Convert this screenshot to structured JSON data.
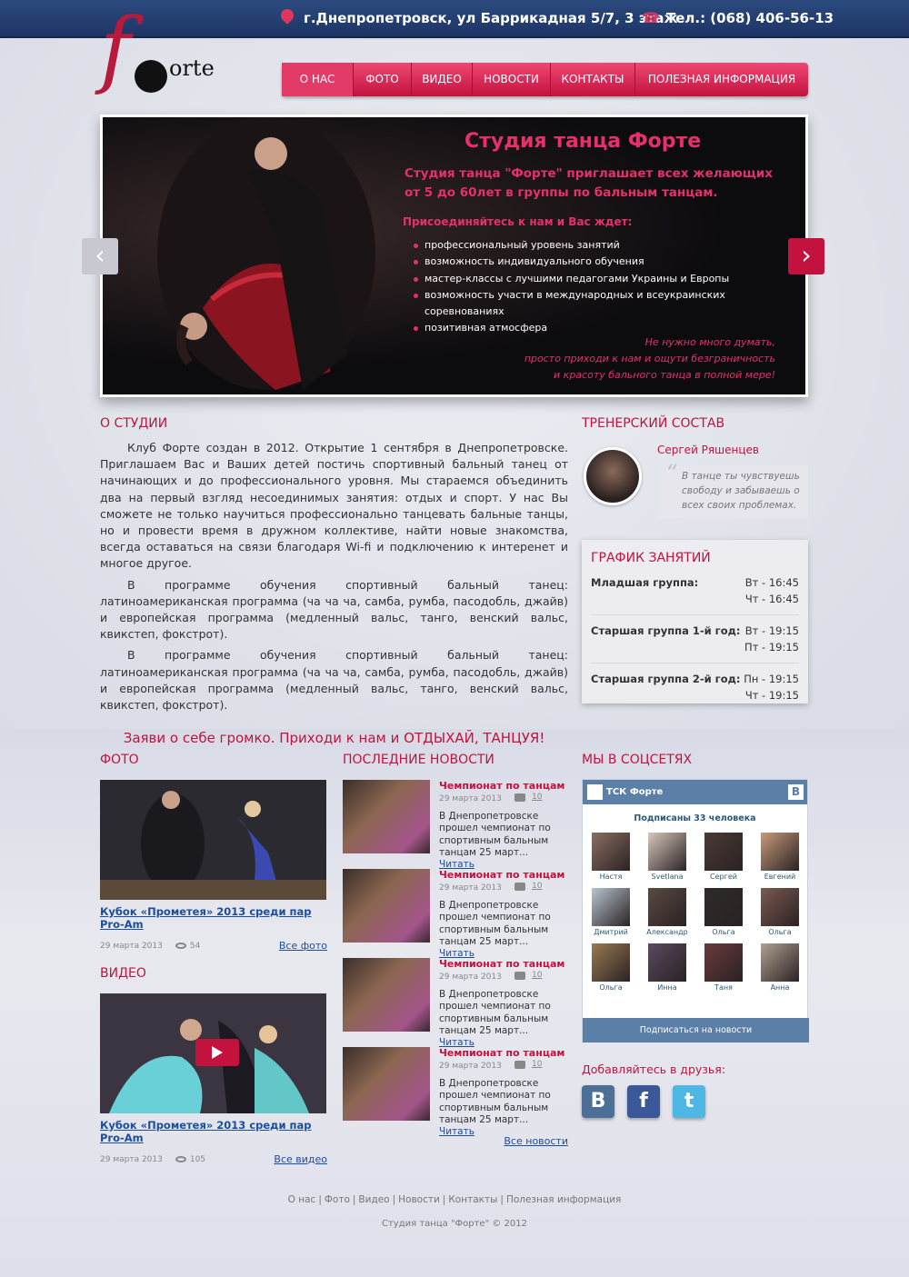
{
  "header": {
    "address": "г.Днепропетровск, ул Баррикадная 5/7, 3 этаж",
    "phone": "Тел.: (068) 406-56-13",
    "logo_letter": "f",
    "logo_text": "orte"
  },
  "nav": [
    {
      "label": "О НАС",
      "active": true
    },
    {
      "label": "ФОТО"
    },
    {
      "label": "ВИДЕО"
    },
    {
      "label": "НОВОСТИ"
    },
    {
      "label": "КОНТАКТЫ"
    },
    {
      "label": "ПОЛЕЗНАЯ ИНФОРМАЦИЯ"
    }
  ],
  "slider": {
    "title": "Студия танца Форте",
    "intro": "Студия танца \"Форте\" приглашает всех желающих от 5 до 60лет в группы по бальным танцам.",
    "join": "Присоединяйтесь к нам и Вас ждет:",
    "bullets": [
      "профессиональный уровень занятий",
      "возможность индивидуального обучения",
      "мастер-классы с лучшими педагогами Украины и Европы",
      "возможность участи в международных и всеукраинских соревнованиях",
      "позитивная атмосфера"
    ],
    "quote_lines": [
      "Не нужно много думать,",
      "просто приходи к нам и ощути безграничность",
      "и красоту бального танца в полной мере!"
    ]
  },
  "about": {
    "heading": "О СТУДИИ",
    "paragraphs": [
      "Клуб Форте создан в 2012. Открытие 1 сентября в Днепропетровске. Приглашаем Вас и Ваших детей постичь спортивный бальный танец от начинающих и до профессионального уровня. Мы стараемся объединить два на первый взгляд несоединимых занятия: отдых и спорт. У нас Вы сможете не только научиться профессионально танцевать бальные танцы, но и провести время в дружном коллективе, найти новые знакомства, всегда оставаться на связи благодаря Wi-fi и подключению к интеренет и многое другое.",
      "В программе обучения спортивный бальный танец: латиноамериканская программа (ча ча ча, самба, румба, пасодобль, джайв) и европейская программа (медленный вальс, танго, венский вальс, квикстеп, фокстрот).",
      "В программе обучения спортивный бальный танец: латиноамериканская программа (ча ча ча, самба, румба, пасодобль, джайв) и европейская программа (медленный вальс, танго, венский вальс, квикстеп, фокстрот)."
    ],
    "slogan": "Заяви о себе громко. Приходи к нам и ОТДЫХАЙ, ТАНЦУЯ!"
  },
  "trainers": {
    "heading": "ТРЕНЕРСКИЙ СОСТАВ",
    "name": "Сергей Ряшенцев",
    "quote": "В танце ты чувствуешь свободу и забываешь о всех своих проблемах."
  },
  "schedule": {
    "heading": "ГРАФИК ЗАНЯТИЙ",
    "rows": [
      {
        "group": "Младшая группа:",
        "times": [
          "Вт - 16:45",
          "Чт - 16:45"
        ]
      },
      {
        "group": "Старшая группа 1-й год:",
        "times": [
          "Вт - 19:15",
          "Пт - 19:15"
        ]
      },
      {
        "group": "Старшая группа 2-й год:",
        "times": [
          "Пн - 19:15",
          "Чт - 19:15"
        ]
      }
    ]
  },
  "photo": {
    "heading": "ФОТО",
    "caption": "Кубок «Прометея» 2013 среди пар Pro-Am",
    "date": "29 марта 2013",
    "views": "54",
    "all_link": "Все фото"
  },
  "video": {
    "heading": "ВИДЕО",
    "caption": "Кубок «Прометея» 2013 среди пар Pro-Am",
    "date": "29 марта 2013",
    "views": "105",
    "all_link": "Все видео"
  },
  "news": {
    "heading": "ПОСЛЕДНИЕ НОВОСТИ",
    "items": [
      {
        "title": "Чемпионат по танцам",
        "date": "29 марта 2013",
        "comments": "10",
        "text": "В Днепропетровске прошел чемпионат по спортивным бальным танцам 25 март...",
        "read": "Читать"
      },
      {
        "title": "Чемпионат по танцам",
        "date": "29 марта 2013",
        "comments": "10",
        "text": "В Днепропетровске прошел чемпионат по спортивным бальным танцам 25 март...",
        "read": "Читать"
      },
      {
        "title": "Чемпионат по танцам",
        "date": "29 марта 2013",
        "comments": "10",
        "text": "В Днепропетровске прошел чемпионат по спортивным бальным танцам 25 март...",
        "read": "Читать"
      },
      {
        "title": "Чемпионат по танцам",
        "date": "29 марта 2013",
        "comments": "10",
        "text": "В Днепропетровске прошел чемпионат по спортивным бальным танцам 25 март...",
        "read": "Читать"
      }
    ],
    "all_link": "Все новости"
  },
  "social": {
    "heading": "МЫ В СОЦСЕТЯХ",
    "group_name": "ТСК Форте",
    "vk_letter": "B",
    "subscribers": "Подписаны 33 человека",
    "people": [
      "Настя",
      "Svetlana",
      "Сергей",
      "Евгений",
      "Дмитрий",
      "Александр",
      "Ольга",
      "Ольга",
      "Ольга",
      "Инна",
      "Таня",
      "Анна"
    ],
    "subscribe": "Подписаться на новости",
    "add_friends": "Добавляйтесь в друзья:",
    "icons": [
      {
        "name": "vk-icon",
        "glyph": "B",
        "color": "#4b6f96"
      },
      {
        "name": "facebook-icon",
        "glyph": "f",
        "color": "#3b5998"
      },
      {
        "name": "twitter-icon",
        "glyph": "t",
        "color": "#4fb7e3"
      }
    ]
  },
  "footer": {
    "links": [
      "О нас",
      "Фото",
      "Видео",
      "Новости",
      "Контакты",
      "Полезная информация"
    ],
    "copyright": "Студия танца \"Форте\" © 2012"
  },
  "colors": {
    "accent": "#c4123e",
    "topbar": "#1d3565",
    "link": "#1b4d9e"
  }
}
